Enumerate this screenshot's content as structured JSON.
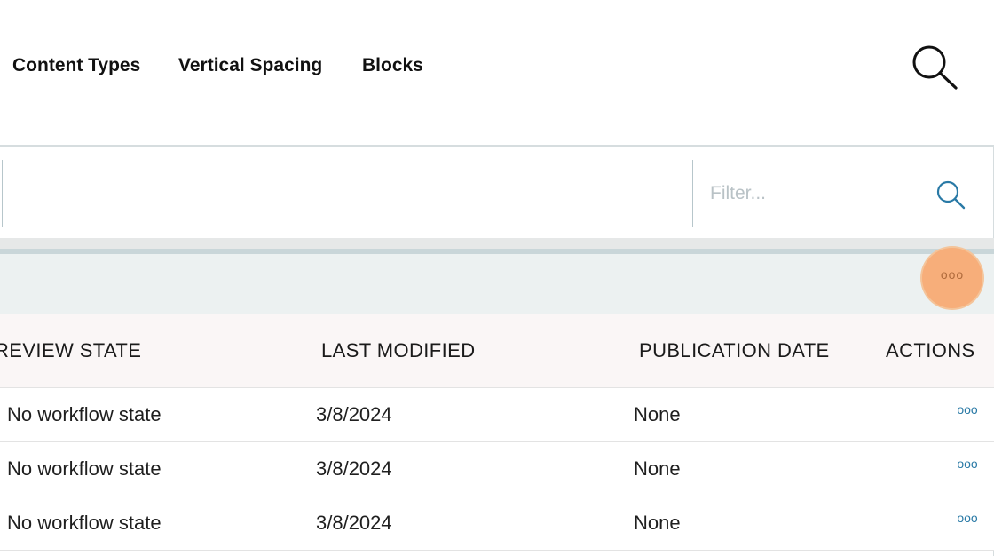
{
  "nav": {
    "items": [
      {
        "label": "Content Types"
      },
      {
        "label": "Vertical Spacing"
      },
      {
        "label": "Blocks"
      }
    ],
    "search_icon": "search-icon"
  },
  "contents": {
    "filter": {
      "placeholder": "Filter...",
      "value": "",
      "icon": "search-icon"
    },
    "toolbar": {
      "more_button_label": "ooo",
      "more_icon": "more-dots-icon",
      "highlight_color": "#f7ae7a"
    },
    "table": {
      "columns": [
        {
          "label": "REVIEW STATE"
        },
        {
          "label": "LAST MODIFIED"
        },
        {
          "label": "PUBLICATION DATE"
        },
        {
          "label": "ACTIONS"
        }
      ],
      "rows": [
        {
          "review_state": "No workflow state",
          "last_modified": "3/8/2024",
          "publication_date": "None",
          "actions": "ooo"
        },
        {
          "review_state": "No workflow state",
          "last_modified": "3/8/2024",
          "publication_date": "None",
          "actions": "ooo"
        },
        {
          "review_state": "No workflow state",
          "last_modified": "3/8/2024",
          "publication_date": "None",
          "actions": "ooo"
        }
      ]
    }
  },
  "colors": {
    "accent_blue": "#2a7aa6",
    "toolbar_bg": "#ecf1f1",
    "header_bg": "#faf6f6"
  }
}
